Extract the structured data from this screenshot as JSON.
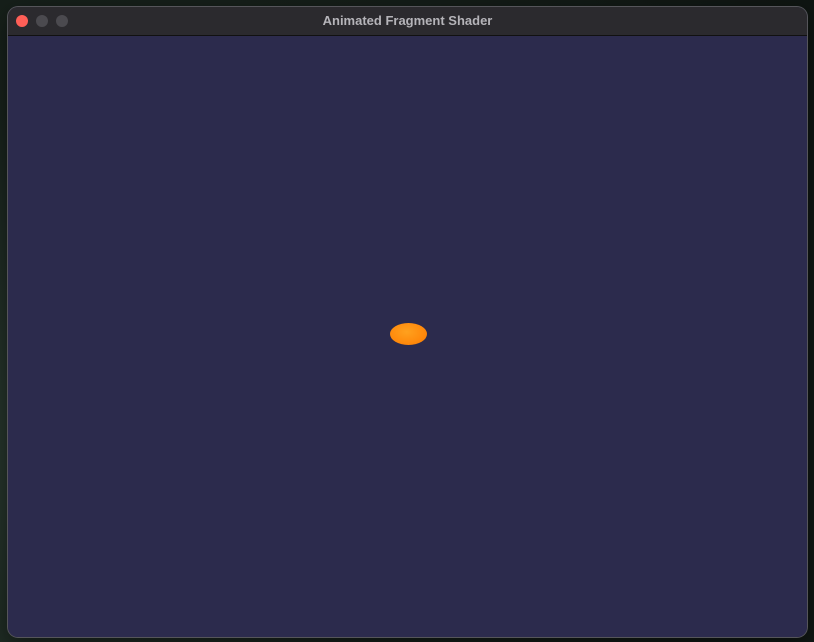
{
  "window": {
    "title": "Animated Fragment Shader"
  },
  "colors": {
    "canvas_background": "#2c2b4d",
    "shape_fill": "#ff8a0c",
    "close_button": "#ff5f57",
    "inactive_button": "#4b4a4f"
  },
  "shape": {
    "kind": "ellipse"
  }
}
